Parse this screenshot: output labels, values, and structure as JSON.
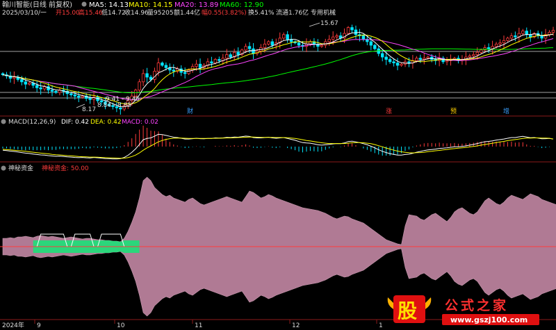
{
  "header": {
    "stock_name": "翰川智能(日线 前复权)",
    "ma5": "MA5: 14.13",
    "ma10": "MA10: 14.15",
    "ma20": "MA20: 13.89",
    "ma60": "MA60: 12.90",
    "date": "2025/03/10/一",
    "open": "开15.00",
    "high": "高15.46",
    "low": "低14.72",
    "close": "收14.96",
    "volume": "量95205",
    "amount": "额1.44亿",
    "amplitude": "幅0.55(3.82%)",
    "turnover": "换5.41%",
    "float": "流通1.76亿",
    "sector": "专用机械"
  },
  "price_annotations": {
    "high_mark": "15.67",
    "level_1": "9.41 - 9.45",
    "level_2": "8.84 - 8.85",
    "low_mark": "8.17"
  },
  "event_labels": [
    "财",
    "涨",
    "预",
    "增"
  ],
  "macd": {
    "title": "MACD(12,26,9)",
    "dif": "DIF: 0.42",
    "dea": "DEA: 0.42",
    "macd": "MACD: 0.02"
  },
  "indicator": {
    "title": "神秘资金",
    "label": "神秘资金: 50.00"
  },
  "time_axis": [
    "2024年",
    "9",
    "10",
    "11",
    "12",
    "1"
  ],
  "watermark": {
    "logo_char": "股",
    "name": "公式之家",
    "url": "www.gszj100.com"
  },
  "colors": {
    "up": "#ff3b3b",
    "down": "#00e5ff",
    "ma5": "#ffffff",
    "ma10": "#ffff00",
    "ma20": "#ff44ff",
    "ma60": "#00ff00",
    "fund_fill": "#b07a94",
    "fund_green": "#2bd67b"
  },
  "chart_data": {
    "type": "candlestick",
    "title": "翰川智能(日线 前复权)",
    "ylim": [
      8.0,
      16.0
    ],
    "series": [
      {
        "name": "MA5",
        "last": 14.13
      },
      {
        "name": "MA10",
        "last": 14.15
      },
      {
        "name": "MA20",
        "last": 13.89
      },
      {
        "name": "MA60",
        "last": 12.9
      }
    ],
    "close": [
      11.2,
      11.1,
      10.9,
      11.0,
      10.8,
      10.6,
      10.4,
      10.5,
      10.3,
      10.1,
      10.0,
      10.2,
      9.9,
      9.8,
      9.7,
      9.9,
      9.8,
      9.6,
      9.5,
      9.4,
      9.3,
      9.4,
      9.2,
      9.1,
      9.3,
      9.0,
      8.9,
      8.7,
      8.6,
      8.5,
      8.4,
      8.3,
      8.6,
      9.0,
      9.4,
      9.9,
      10.6,
      11.3,
      11.0,
      10.8,
      11.5,
      12.2,
      12.0,
      11.8,
      11.6,
      11.5,
      11.7,
      11.4,
      11.3,
      11.6,
      11.9,
      12.1,
      11.8,
      12.0,
      12.3,
      12.2,
      12.5,
      12.4,
      12.6,
      12.9,
      12.7,
      13.1,
      12.9,
      13.3,
      13.6,
      13.4,
      13.0,
      13.2,
      13.5,
      13.8,
      14.0,
      13.7,
      13.9,
      14.3,
      14.6,
      14.2,
      14.0,
      13.9,
      13.7,
      13.6,
      13.8,
      14.0,
      13.8,
      13.6,
      13.7,
      14.0,
      14.2,
      14.4,
      14.5,
      14.3,
      14.7,
      15.2,
      15.0,
      14.6,
      14.5,
      14.2,
      14.0,
      13.7,
      13.4,
      13.0,
      12.7,
      12.5,
      12.3,
      12.2,
      12.0,
      12.1,
      12.3,
      12.2,
      12.4,
      12.6,
      12.5,
      12.6,
      12.7,
      12.5,
      12.4,
      12.6,
      12.3,
      12.4,
      12.5,
      12.6,
      12.4,
      12.5,
      12.7,
      12.8,
      12.9,
      13.1,
      13.3,
      13.5,
      13.4,
      13.6,
      13.8,
      13.9,
      14.1,
      14.3,
      14.5,
      14.4,
      14.7,
      14.9,
      14.6,
      14.4,
      14.7,
      14.5,
      14.3,
      14.6,
      14.8,
      14.96
    ],
    "dif": [
      -0.2,
      -0.22,
      -0.25,
      -0.27,
      -0.3,
      -0.33,
      -0.36,
      -0.38,
      -0.41,
      -0.44,
      -0.46,
      -0.47,
      -0.5,
      -0.52,
      -0.54,
      -0.53,
      -0.55,
      -0.57,
      -0.58,
      -0.6,
      -0.61,
      -0.6,
      -0.62,
      -0.63,
      -0.6,
      -0.62,
      -0.64,
      -0.66,
      -0.67,
      -0.68,
      -0.68,
      -0.67,
      -0.6,
      -0.48,
      -0.32,
      -0.12,
      0.12,
      0.38,
      0.45,
      0.48,
      0.58,
      0.68,
      0.66,
      0.62,
      0.57,
      0.52,
      0.5,
      0.46,
      0.42,
      0.42,
      0.44,
      0.46,
      0.44,
      0.43,
      0.45,
      0.45,
      0.48,
      0.47,
      0.48,
      0.51,
      0.5,
      0.53,
      0.52,
      0.55,
      0.58,
      0.56,
      0.5,
      0.48,
      0.48,
      0.5,
      0.52,
      0.48,
      0.46,
      0.48,
      0.5,
      0.45,
      0.4,
      0.35,
      0.28,
      0.22,
      0.2,
      0.19,
      0.15,
      0.1,
      0.08,
      0.1,
      0.12,
      0.15,
      0.17,
      0.16,
      0.2,
      0.28,
      0.3,
      0.26,
      0.22,
      0.16,
      0.1,
      0.02,
      -0.07,
      -0.17,
      -0.26,
      -0.33,
      -0.39,
      -0.43,
      -0.47,
      -0.47,
      -0.44,
      -0.42,
      -0.37,
      -0.31,
      -0.27,
      -0.22,
      -0.18,
      -0.16,
      -0.14,
      -0.1,
      -0.09,
      -0.07,
      -0.04,
      -0.01,
      -0.01,
      0.01,
      0.04,
      0.08,
      0.12,
      0.17,
      0.22,
      0.27,
      0.29,
      0.32,
      0.36,
      0.39,
      0.42,
      0.46,
      0.5,
      0.5,
      0.54,
      0.57,
      0.53,
      0.49,
      0.5,
      0.47,
      0.43,
      0.44,
      0.45,
      0.42
    ],
    "dea": [
      -0.15,
      -0.17,
      -0.18,
      -0.2,
      -0.22,
      -0.24,
      -0.26,
      -0.29,
      -0.31,
      -0.34,
      -0.36,
      -0.38,
      -0.4,
      -0.43,
      -0.45,
      -0.46,
      -0.48,
      -0.5,
      -0.51,
      -0.53,
      -0.55,
      -0.56,
      -0.57,
      -0.58,
      -0.58,
      -0.59,
      -0.6,
      -0.61,
      -0.62,
      -0.63,
      -0.64,
      -0.65,
      -0.64,
      -0.61,
      -0.55,
      -0.47,
      -0.35,
      -0.2,
      -0.07,
      0.04,
      0.15,
      0.26,
      0.34,
      0.4,
      0.44,
      0.46,
      0.47,
      0.47,
      0.46,
      0.45,
      0.45,
      0.45,
      0.45,
      0.45,
      0.45,
      0.45,
      0.46,
      0.46,
      0.47,
      0.48,
      0.48,
      0.49,
      0.5,
      0.51,
      0.52,
      0.53,
      0.53,
      0.52,
      0.51,
      0.51,
      0.51,
      0.51,
      0.5,
      0.5,
      0.5,
      0.49,
      0.47,
      0.45,
      0.42,
      0.38,
      0.34,
      0.31,
      0.28,
      0.24,
      0.21,
      0.19,
      0.17,
      0.17,
      0.17,
      0.17,
      0.17,
      0.19,
      0.21,
      0.22,
      0.22,
      0.21,
      0.19,
      0.16,
      0.11,
      0.05,
      -0.01,
      -0.08,
      -0.14,
      -0.2,
      -0.25,
      -0.29,
      -0.32,
      -0.34,
      -0.35,
      -0.34,
      -0.33,
      -0.31,
      -0.28,
      -0.26,
      -0.23,
      -0.21,
      -0.18,
      -0.16,
      -0.13,
      -0.11,
      -0.09,
      -0.07,
      -0.05,
      -0.02,
      0.01,
      0.04,
      0.08,
      0.12,
      0.15,
      0.19,
      0.22,
      0.26,
      0.29,
      0.33,
      0.36,
      0.39,
      0.42,
      0.45,
      0.47,
      0.47,
      0.48,
      0.48,
      0.47,
      0.47,
      0.46,
      0.42
    ],
    "fund": [
      12,
      12,
      13,
      12,
      14,
      14,
      15,
      14,
      13,
      15,
      16,
      15,
      14,
      15,
      14,
      13,
      12,
      13,
      14,
      13,
      12,
      11,
      12,
      12,
      11,
      10,
      10,
      9,
      9,
      8,
      8,
      7,
      12,
      22,
      35,
      50,
      70,
      95,
      100,
      95,
      85,
      80,
      75,
      72,
      74,
      70,
      68,
      66,
      64,
      68,
      70,
      66,
      62,
      60,
      62,
      64,
      66,
      68,
      70,
      72,
      70,
      68,
      66,
      64,
      72,
      80,
      78,
      74,
      70,
      72,
      75,
      73,
      70,
      68,
      66,
      64,
      62,
      60,
      58,
      56,
      55,
      54,
      53,
      52,
      50,
      48,
      45,
      42,
      40,
      42,
      44,
      43,
      40,
      38,
      36,
      34,
      30,
      26,
      22,
      18,
      14,
      10,
      8,
      6,
      4,
      3,
      30,
      46,
      45,
      44,
      40,
      38,
      42,
      46,
      48,
      44,
      40,
      36,
      42,
      50,
      54,
      56,
      52,
      48,
      46,
      50,
      58,
      66,
      70,
      66,
      62,
      60,
      64,
      70,
      74,
      72,
      70,
      68,
      72,
      76,
      74,
      72,
      68,
      66,
      64,
      62,
      60,
      58
    ],
    "green_segment": [
      8,
      36
    ]
  }
}
